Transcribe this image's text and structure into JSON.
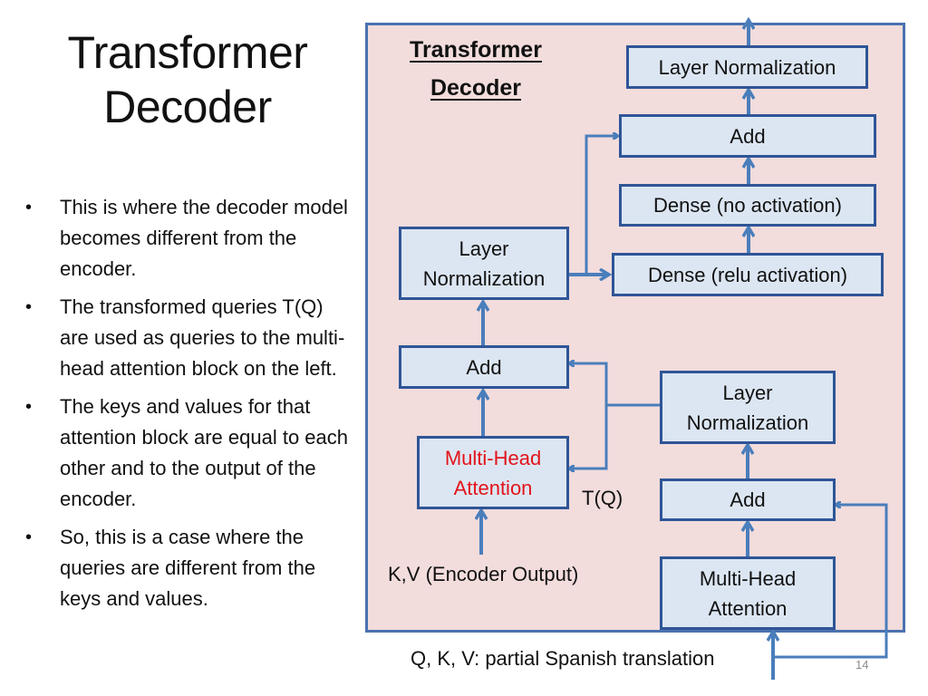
{
  "slide": {
    "title_line1": "Transformer",
    "title_line2": "Decoder",
    "bullets": [
      "This is where the decoder model becomes different from the encoder.",
      "The transformed queries T(Q) are used as queries to the multi-head attention block on the left.",
      "The keys and values for that attention block are equal to each other and to the output of the encoder.",
      "So, this is a case where the queries are different from the keys and values."
    ],
    "page_number": "14"
  },
  "diagram": {
    "title_line1": "Transformer",
    "title_line2": "Decoder",
    "colors": {
      "panel_bg": "#f2dcdc",
      "box_bg": "#dce6f2",
      "box_border": "#2f5597",
      "arrow": "#4a7ebb",
      "highlight_text": "#e3141b"
    },
    "boxes": {
      "top_layer_norm": "Layer Normalization",
      "top_add": "Add",
      "dense_no_act": "Dense (no activation)",
      "dense_relu": "Dense (relu activation)",
      "left_layer_norm_line1": "Layer",
      "left_layer_norm_line2": "Normalization",
      "left_add": "Add",
      "cross_attention_line1": "Multi-Head",
      "cross_attention_line2": "Attention",
      "right_layer_norm_line1": "Layer",
      "right_layer_norm_line2": "Normalization",
      "right_add": "Add",
      "self_attention_line1": "Multi-Head",
      "self_attention_line2": "Attention"
    },
    "labels": {
      "tq": "T(Q)",
      "kv_input": "K,V (Encoder Output)",
      "qkv_input": "Q, K, V: partial Spanish translation"
    }
  }
}
